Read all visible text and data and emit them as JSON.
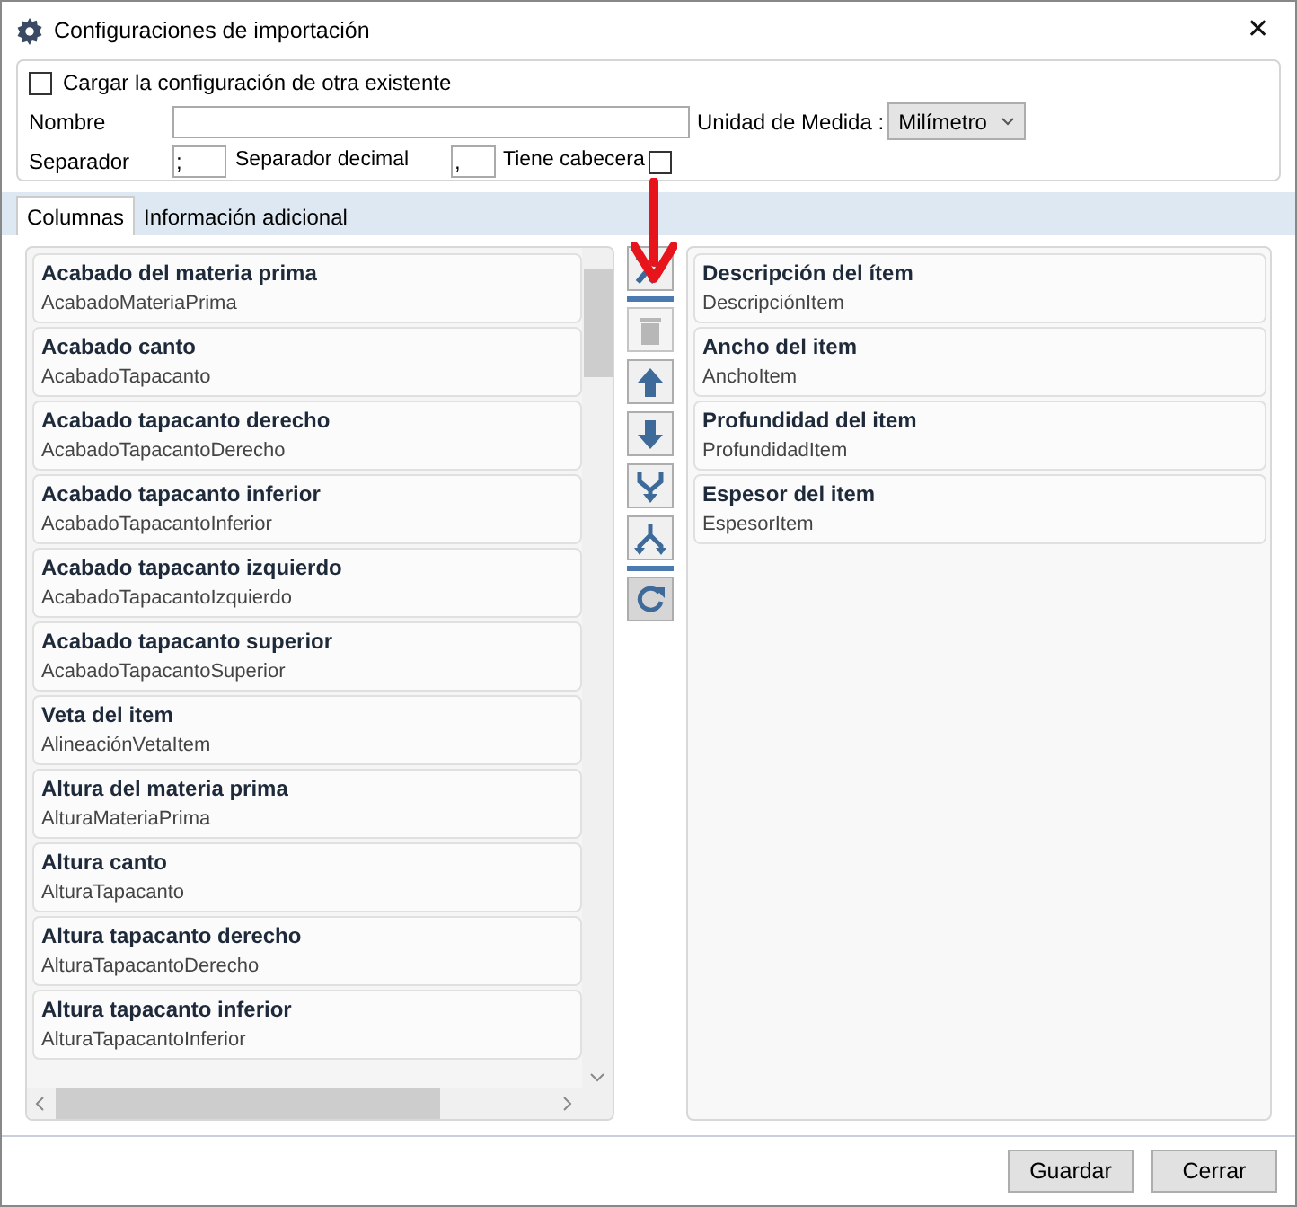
{
  "window": {
    "title": "Configuraciones de importación",
    "close": "✕"
  },
  "options": {
    "load_existing": {
      "label": "Cargar la configuración de otra existente",
      "checked": false
    },
    "name": {
      "label": "Nombre"
    },
    "unit": {
      "label": "Unidad de Medida :",
      "value": "Milímetro"
    },
    "separator": {
      "label": "Separador",
      "value": ";"
    },
    "decimal_separator": {
      "label": "Separador decimal",
      "value": ","
    },
    "has_header": {
      "label": "Tiene cabecera",
      "checked": false
    }
  },
  "tabs": [
    {
      "label": "Columnas",
      "selected": true
    },
    {
      "label": "Información adicional",
      "selected": false
    }
  ],
  "available_columns": [
    {
      "title": "Acabado del materia prima",
      "field": "AcabadoMateriaPrima"
    },
    {
      "title": "Acabado canto",
      "field": "AcabadoTapacanto"
    },
    {
      "title": "Acabado tapacanto derecho",
      "field": "AcabadoTapacantoDerecho"
    },
    {
      "title": "Acabado tapacanto inferior",
      "field": "AcabadoTapacantoInferior"
    },
    {
      "title": "Acabado tapacanto izquierdo",
      "field": "AcabadoTapacantoIzquierdo"
    },
    {
      "title": "Acabado tapacanto superior",
      "field": "AcabadoTapacantoSuperior"
    },
    {
      "title": "Veta del item",
      "field": "AlineaciónVetaItem"
    },
    {
      "title": "Altura del materia prima",
      "field": "AlturaMateriaPrima"
    },
    {
      "title": "Altura canto",
      "field": "AlturaTapacanto"
    },
    {
      "title": "Altura tapacanto derecho",
      "field": "AlturaTapacantoDerecho"
    },
    {
      "title": "Altura tapacanto inferior",
      "field": "AlturaTapacantoInferior"
    }
  ],
  "tools": [
    {
      "kind": "add_all",
      "disabled": false
    },
    {
      "kind": "delete",
      "disabled": true
    },
    {
      "kind": "up",
      "disabled": false
    },
    {
      "kind": "down",
      "disabled": false
    },
    {
      "kind": "merge",
      "disabled": false
    },
    {
      "kind": "split",
      "disabled": false
    },
    {
      "kind": "reset",
      "disabled": false
    }
  ],
  "selected_columns": [
    {
      "title": "Descripción del ítem",
      "field": "DescripciónItem"
    },
    {
      "title": "Ancho del item",
      "field": "AnchoItem"
    },
    {
      "title": "Profundidad del item",
      "field": "ProfundidadItem"
    },
    {
      "title": "Espesor del item",
      "field": "EspesorItem"
    }
  ],
  "buttons": [
    "Guardar",
    "Cerrar"
  ]
}
